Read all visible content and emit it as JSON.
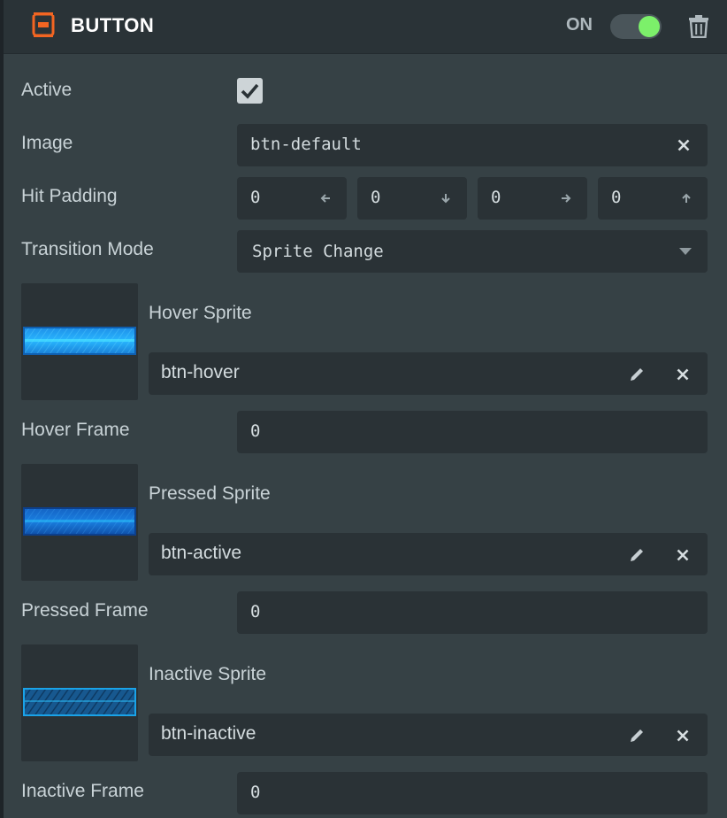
{
  "header": {
    "title": "BUTTON",
    "toggle_label": "ON",
    "toggle_on": true,
    "accent_color": "#f26522",
    "toggle_color": "#7cf06a"
  },
  "fields": {
    "active": {
      "label": "Active",
      "checked": true
    },
    "image": {
      "label": "Image",
      "value": "btn-default"
    },
    "hit_padding": {
      "label": "Hit Padding",
      "values": [
        "0",
        "0",
        "0",
        "0"
      ]
    },
    "transition_mode": {
      "label": "Transition Mode",
      "value": "Sprite Change"
    },
    "hover_sprite": {
      "label": "Hover Sprite",
      "value": "btn-hover"
    },
    "hover_frame": {
      "label": "Hover Frame",
      "value": "0"
    },
    "pressed_sprite": {
      "label": "Pressed Sprite",
      "value": "btn-active"
    },
    "pressed_frame": {
      "label": "Pressed Frame",
      "value": "0"
    },
    "inactive_sprite": {
      "label": "Inactive Sprite",
      "value": "btn-inactive"
    },
    "inactive_frame": {
      "label": "Inactive Frame",
      "value": "0"
    }
  },
  "icons": [
    "button-component-icon",
    "trash-icon",
    "check-icon",
    "close-icon",
    "pencil-icon",
    "arrow-left-icon",
    "arrow-down-icon",
    "arrow-right-icon",
    "arrow-up-icon",
    "chevron-down-icon"
  ]
}
